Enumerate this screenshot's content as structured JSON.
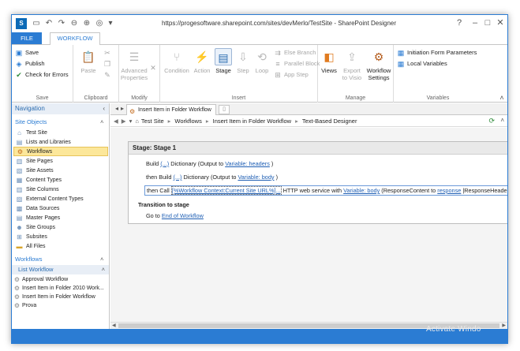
{
  "window": {
    "title": "https://progesoftware.sharepoint.com/sites/devMerlo/TestSite - SharePoint Designer",
    "app_icon": "sharepoint-designer-logo",
    "controls": [
      "?",
      "–",
      "□",
      "✕"
    ]
  },
  "ribbon_tabs": [
    {
      "label": "FILE",
      "active": false
    },
    {
      "label": "WORKFLOW",
      "active": true
    }
  ],
  "ribbon": {
    "save": {
      "label": "Save",
      "items": [
        {
          "label": "Save",
          "icon": "save-icon"
        },
        {
          "label": "Publish",
          "icon": "publish-icon"
        },
        {
          "label": "Check for Errors",
          "icon": "check-errors-icon"
        }
      ]
    },
    "clipboard": {
      "label": "Clipboard",
      "paste": "Paste"
    },
    "modify": {
      "label": "Modify",
      "advanced": "Advanced\nProperties"
    },
    "insert": {
      "label": "Insert",
      "condition": "Condition",
      "action": "Action",
      "stage": "Stage",
      "step": "Step",
      "loop": "Loop",
      "else_branch": "Else Branch",
      "parallel_block": "Parallel Block",
      "app_step": "App Step"
    },
    "manage": {
      "label": "Manage",
      "views": "Views",
      "export": "Export\nto Visio",
      "settings": "Workflow\nSettings"
    },
    "variables": {
      "label": "Variables",
      "init_params": "Initiation Form Parameters",
      "local_vars": "Local Variables"
    }
  },
  "navigation": {
    "title": "Navigation",
    "site_objects_label": "Site Objects",
    "site_objects": [
      {
        "label": "Test Site",
        "icon": "home-icon",
        "selected": false
      },
      {
        "label": "Lists and Libraries",
        "icon": "list-icon",
        "selected": false
      },
      {
        "label": "Workflows",
        "icon": "workflow-icon",
        "selected": true
      },
      {
        "label": "Site Pages",
        "icon": "page-icon",
        "selected": false
      },
      {
        "label": "Site Assets",
        "icon": "assets-icon",
        "selected": false
      },
      {
        "label": "Content Types",
        "icon": "content-types-icon",
        "selected": false
      },
      {
        "label": "Site Columns",
        "icon": "columns-icon",
        "selected": false
      },
      {
        "label": "External Content Types",
        "icon": "external-icon",
        "selected": false
      },
      {
        "label": "Data Sources",
        "icon": "data-sources-icon",
        "selected": false
      },
      {
        "label": "Master Pages",
        "icon": "master-pages-icon",
        "selected": false
      },
      {
        "label": "Site Groups",
        "icon": "groups-icon",
        "selected": false
      },
      {
        "label": "Subsites",
        "icon": "subsites-icon",
        "selected": false
      },
      {
        "label": "All Files",
        "icon": "folder-icon",
        "selected": false
      }
    ],
    "workflows_label": "Workflows",
    "list_workflow_label": "List Workflow",
    "workflows": [
      "Approval Workflow",
      "Insert Item in Folder 2010 Work...",
      "Insert Item in Folder Workflow",
      "Prova"
    ]
  },
  "document": {
    "tab_label": "Insert Item in Folder Workflow",
    "breadcrumb": [
      "Test Site",
      "Workflows",
      "Insert Item in Folder Workflow",
      "Text-Based Designer"
    ],
    "stage_title": "Stage: Stage 1",
    "actions": [
      {
        "prefix": "Build",
        "l1": "(...)",
        "mid": "Dictionary (Output to",
        "l2": "Variable: headers",
        "suffix": ")"
      },
      {
        "prefix": "then Build",
        "l1": "(...)",
        "mid": "Dictionary (Output to",
        "l2": "Variable: body",
        "suffix": ")"
      }
    ],
    "call_action": {
      "prefix": "then Call",
      "url": "[%Workflow Context:Current Site URL%]...",
      "mid": "HTTP web service with",
      "body": "Variable: body",
      "mid2": "(ResponseContent to",
      "resp": "response",
      "mid3": "|ResponseHeaders to",
      "tail": "res"
    },
    "transition_label": "Transition to stage",
    "goto_prefix": "Go to",
    "goto_target": "End of Workflow"
  },
  "watermark": "Activate Windo",
  "colors": {
    "accent": "#2b7cd3",
    "selection": "#fce79a",
    "link": "#1f5fb4"
  }
}
